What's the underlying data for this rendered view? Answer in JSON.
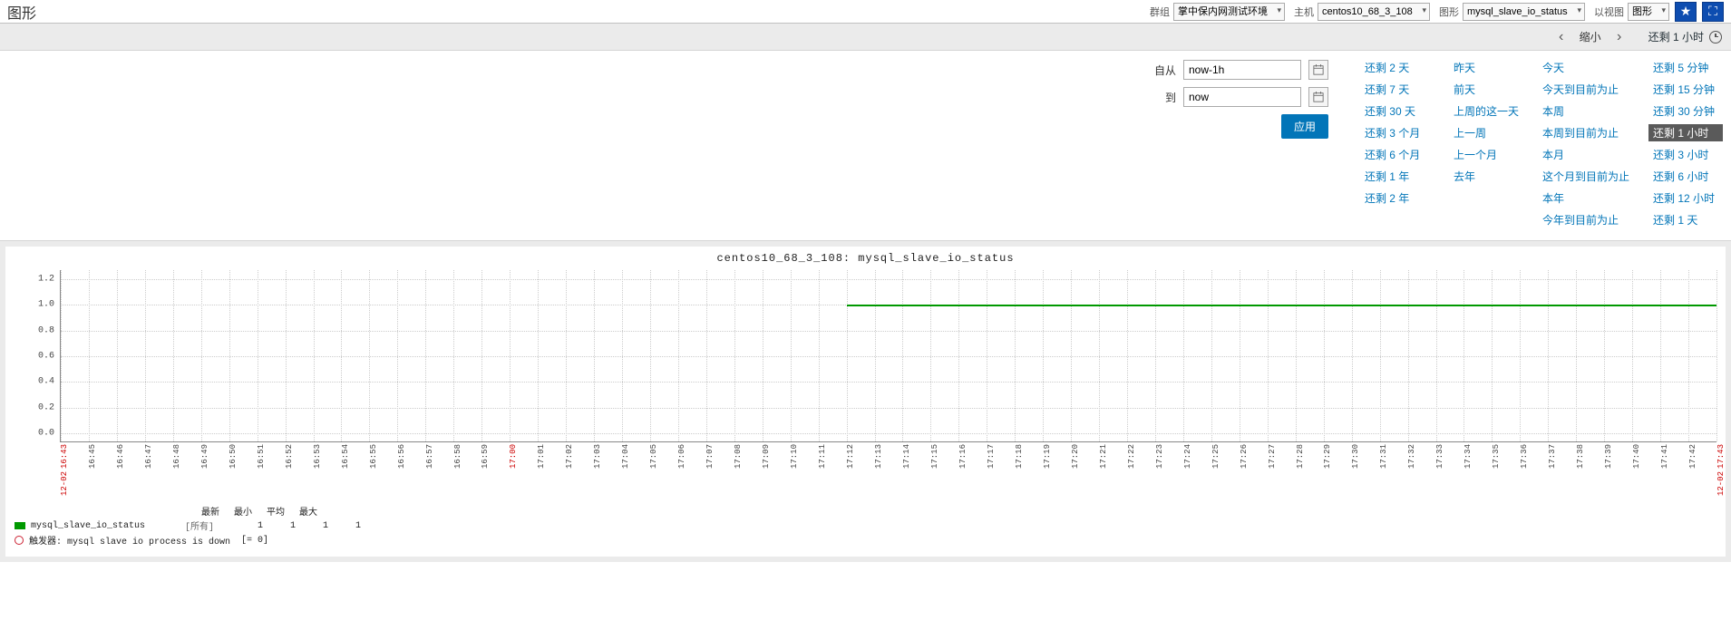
{
  "topbar": {
    "title": "图形",
    "filters": {
      "group_label": "群组",
      "group_value": "掌中保内网测试环境",
      "host_label": "主机",
      "host_value": "centos10_68_3_108",
      "graph_label": "图形",
      "graph_value": "mysql_slave_io_status",
      "view_label": "以视图",
      "view_value": "图形"
    }
  },
  "timenav": {
    "zoom_out": "缩小",
    "current": "还剩 1 小时"
  },
  "panel": {
    "from_label": "自从",
    "from_value": "now-1h",
    "to_label": "到",
    "to_value": "now",
    "apply": "应用"
  },
  "presets": {
    "col1": [
      "还剩 2 天",
      "还剩 7 天",
      "还剩 30 天",
      "还剩 3 个月",
      "还剩 6 个月",
      "还剩 1 年",
      "还剩 2 年"
    ],
    "col2": [
      "昨天",
      "前天",
      "上周的这一天",
      "上一周",
      "上一个月",
      "去年"
    ],
    "col3": [
      "今天",
      "今天到目前为止",
      "本周",
      "本周到目前为止",
      "本月",
      "这个月到目前为止",
      "本年",
      "今年到目前为止"
    ],
    "col4": [
      "还剩 5 分钟",
      "还剩 15 分钟",
      "还剩 30 分钟",
      "还剩 1 小时",
      "还剩 3 小时",
      "还剩 6 小时",
      "还剩 12 小时",
      "还剩 1 天"
    ],
    "active": "还剩 1 小时"
  },
  "chart_data": {
    "type": "line",
    "title": "centos10_68_3_108: mysql_slave_io_status",
    "ylabel": "",
    "xlabel": "",
    "ylim": [
      0,
      1.2
    ],
    "yticks": [
      0,
      0.2,
      0.4,
      0.6,
      0.8,
      1.0,
      1.2
    ],
    "x_start": "16:43",
    "x_end": "17:43",
    "x_date": "12-02",
    "xticks": [
      "16:43",
      "16:45",
      "16:46",
      "16:47",
      "16:48",
      "16:49",
      "16:50",
      "16:51",
      "16:52",
      "16:53",
      "16:54",
      "16:55",
      "16:56",
      "16:57",
      "16:58",
      "16:59",
      "17:00",
      "17:01",
      "17:02",
      "17:03",
      "17:04",
      "17:05",
      "17:06",
      "17:07",
      "17:08",
      "17:09",
      "17:10",
      "17:11",
      "17:12",
      "17:13",
      "17:14",
      "17:15",
      "17:16",
      "17:17",
      "17:18",
      "17:19",
      "17:20",
      "17:21",
      "17:22",
      "17:23",
      "17:24",
      "17:25",
      "17:26",
      "17:27",
      "17:28",
      "17:29",
      "17:30",
      "17:31",
      "17:32",
      "17:33",
      "17:34",
      "17:35",
      "17:36",
      "17:37",
      "17:38",
      "17:39",
      "17:40",
      "17:41",
      "17:42",
      "17:43"
    ],
    "hour_mark": "17:00",
    "series": [
      {
        "name": "mysql_slave_io_status",
        "color": "#009900",
        "data_starts_at": "17:12",
        "value": 1
      }
    ],
    "legend": {
      "headers": [
        "最新",
        "最小",
        "平均",
        "最大"
      ],
      "rows": [
        {
          "swatch": "green",
          "name": "mysql_slave_io_status",
          "scope": "[所有]",
          "values": [
            "1",
            "1",
            "1",
            "1"
          ]
        }
      ],
      "trigger": {
        "label": "触发器:",
        "text": "mysql slave io process is down",
        "cond": "[= 0]"
      }
    }
  }
}
